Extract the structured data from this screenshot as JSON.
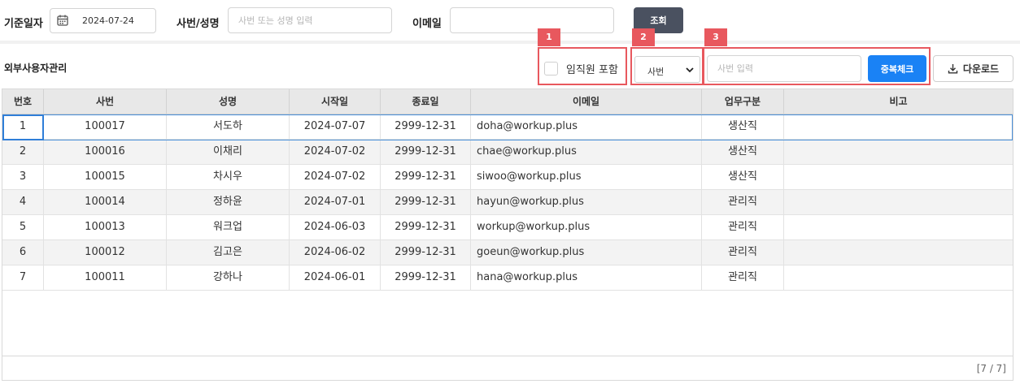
{
  "filter": {
    "date_label": "기준일자",
    "date_value": "2024-07-24",
    "emp_label": "사번/성명",
    "emp_placeholder": "사번 또는 성명 입력",
    "email_label": "이메일",
    "email_value": "",
    "search_button": "조회"
  },
  "section": {
    "title": "외부사용자관리"
  },
  "toolbar": {
    "badge_1": "1",
    "badge_2": "2",
    "badge_3": "3",
    "include_employee_label": "임직원 포함",
    "include_employee_checked": false,
    "search_type_value": "사번",
    "dup_input_placeholder": "사번 입력",
    "dup_check_button": "중복체크",
    "download_button": "다운로드"
  },
  "table": {
    "columns": [
      "번호",
      "사번",
      "성명",
      "시작일",
      "종료일",
      "이메일",
      "업무구분",
      "비고"
    ],
    "rows": [
      [
        "1",
        "100017",
        "서도하",
        "2024-07-07",
        "2999-12-31",
        "doha@workup.plus",
        "생산직",
        ""
      ],
      [
        "2",
        "100016",
        "이채리",
        "2024-07-02",
        "2999-12-31",
        "chae@workup.plus",
        "생산직",
        ""
      ],
      [
        "3",
        "100015",
        "차시우",
        "2024-07-02",
        "2999-12-31",
        "siwoo@workup.plus",
        "생산직",
        ""
      ],
      [
        "4",
        "100014",
        "정하윤",
        "2024-07-01",
        "2999-12-31",
        "hayun@workup.plus",
        "관리직",
        ""
      ],
      [
        "5",
        "100013",
        "워크업",
        "2024-06-03",
        "2999-12-31",
        "workup@workup.plus",
        "관리직",
        ""
      ],
      [
        "6",
        "100012",
        "김고은",
        "2024-06-02",
        "2999-12-31",
        "goeun@workup.plus",
        "관리직",
        ""
      ],
      [
        "7",
        "100011",
        "강하나",
        "2024-06-01",
        "2999-12-31",
        "hana@workup.plus",
        "관리직",
        ""
      ]
    ],
    "footer_count": "[7 / 7]"
  },
  "colors": {
    "primary_button": "#1a82f5",
    "search_button": "#4a5160",
    "annotation": "#e8585e",
    "selection": "#2f7ed8"
  }
}
